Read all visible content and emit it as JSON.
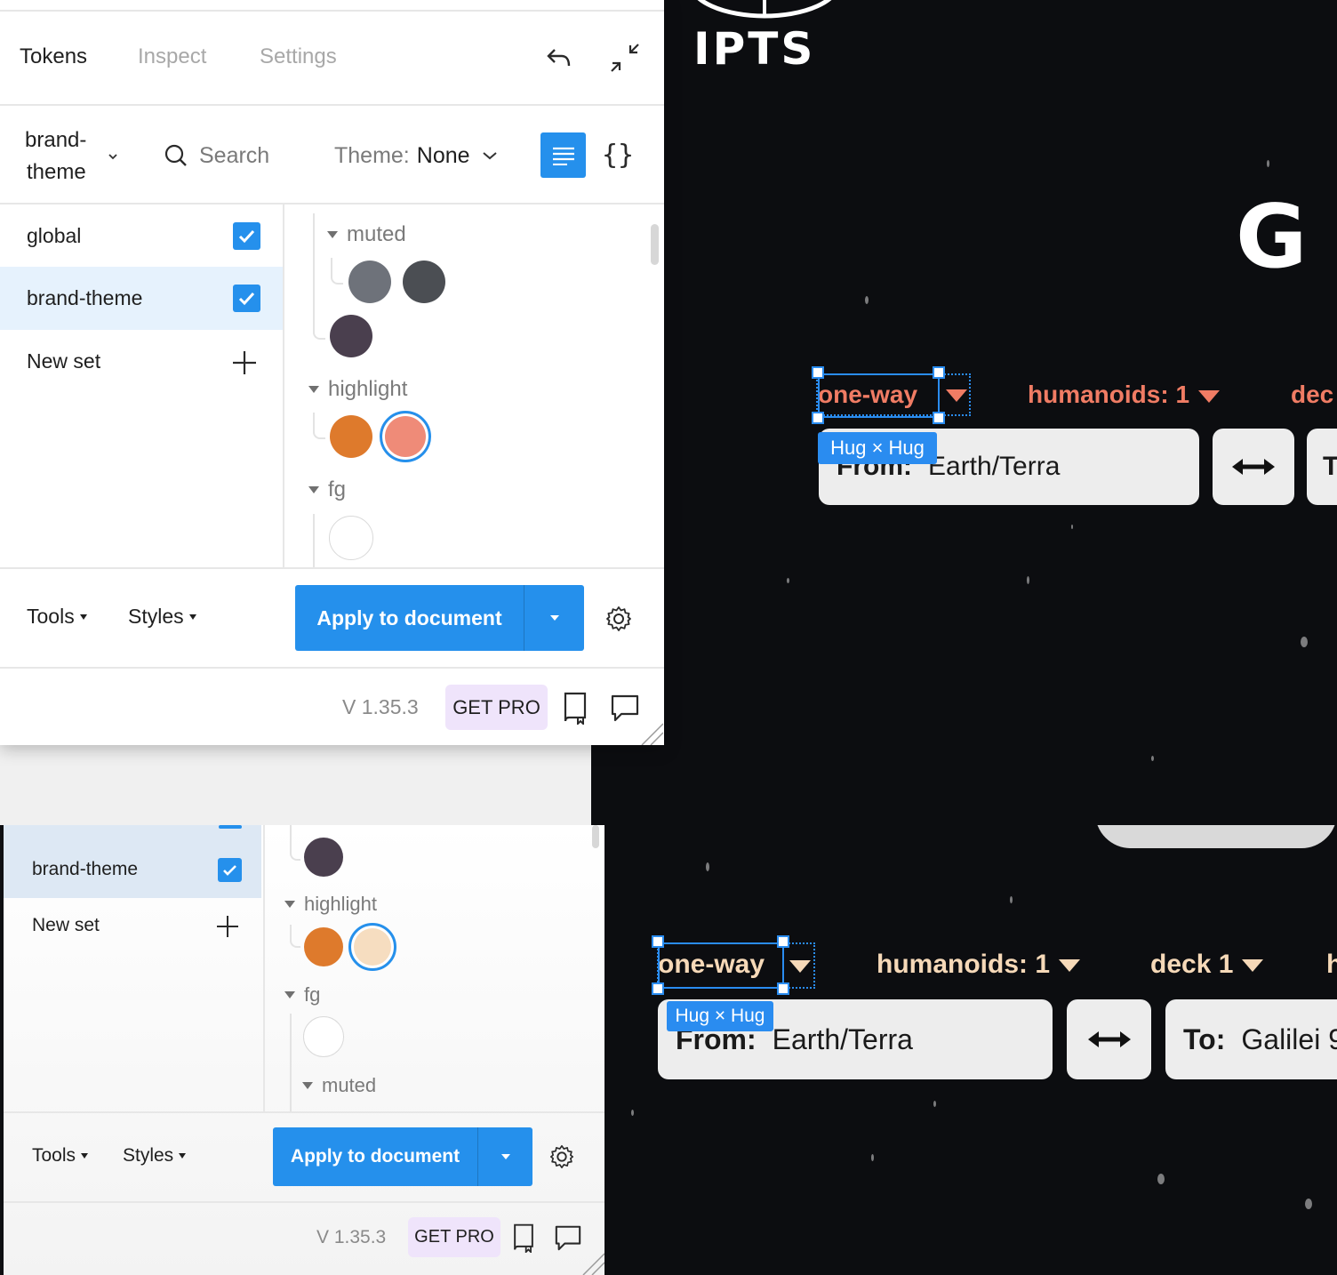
{
  "panel": {
    "tabs": [
      "Tokens",
      "Inspect",
      "Settings"
    ],
    "active_tab": "Tokens",
    "token_set_select": "brand-\ntheme",
    "token_set_line1": "brand-",
    "token_set_line2": "theme",
    "search_label": "Search",
    "theme_prefix": "Theme:",
    "theme_value": "None",
    "sets": [
      {
        "label": "global",
        "checked": true
      },
      {
        "label": "brand-theme",
        "checked": true,
        "selected": true
      }
    ],
    "new_set_label": "New set",
    "groups": {
      "muted": "muted",
      "highlight": "highlight",
      "fg": "fg"
    },
    "colors": {
      "muted_1": "#6e727a",
      "muted_2": "#4b4e53",
      "muted_3": "#4a3f4e",
      "highlight_1": "#de7a2c",
      "highlight_2_top": "#ef8b78",
      "highlight_2_bottom": "#f6ddc0",
      "fg_1": "#ffffff",
      "accent": "#2590ec",
      "pro_bg": "#efe4fb"
    },
    "tools_label": "Tools",
    "styles_label": "Styles",
    "apply_label": "Apply to document",
    "version": "V 1.35.3",
    "get_pro": "GET PRO"
  },
  "canvas": {
    "logo_text": "IPTS",
    "heading_fragment": "G",
    "top_trip_type": "one-way",
    "top_humanoids": "humanoids: 1",
    "top_deck_partial": "dec",
    "bottom_trip_type": "one-way",
    "bottom_humanoids": "humanoids: 1",
    "bottom_deck": "deck 1",
    "hug_badge": "Hug × Hug",
    "from_label": "From:",
    "from_value": "Earth/Terra",
    "to_label": "To:",
    "to_value_partial": "Galilei 9",
    "to_partial_top": "T",
    "colors": {
      "top_accent": "#f07c64",
      "bottom_accent": "#f6d9b8"
    }
  }
}
